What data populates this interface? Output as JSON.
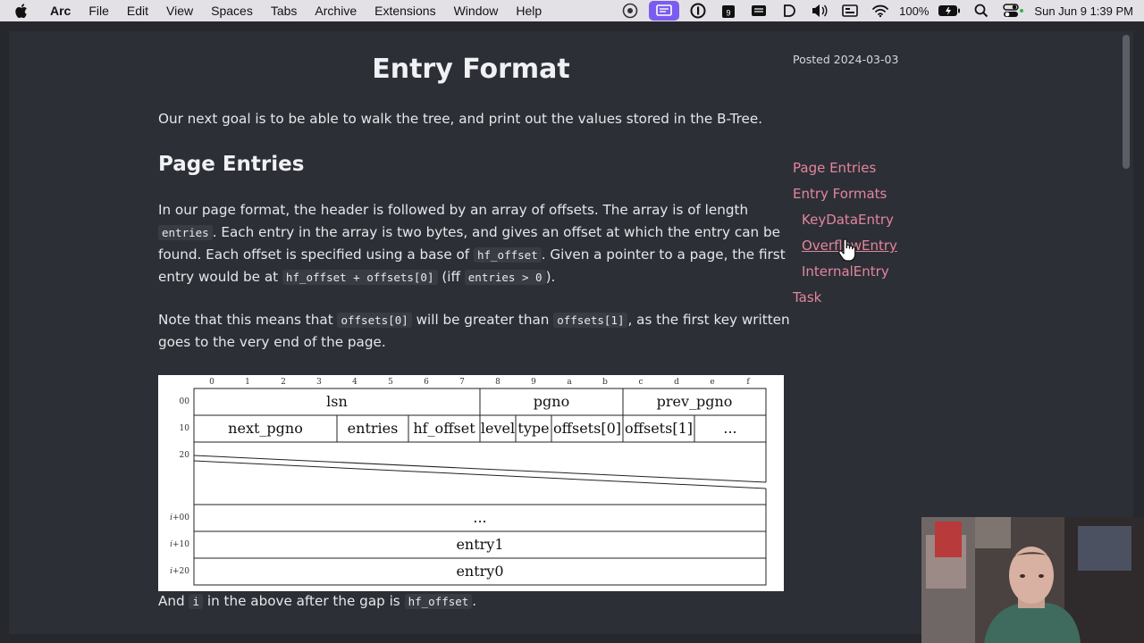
{
  "menubar": {
    "app_name": "Arc",
    "items": [
      "File",
      "Edit",
      "View",
      "Spaces",
      "Tabs",
      "Archive",
      "Extensions",
      "Window",
      "Help"
    ],
    "battery_percent": "100%",
    "datetime": "Sun Jun 9  1:39 PM",
    "icons": [
      "apple-icon",
      "camera-icon",
      "screen-share-icon",
      "onepassword-icon",
      "calendar-icon",
      "grid-icon",
      "d-icon",
      "volume-icon",
      "display-icon",
      "wifi-icon",
      "battery-icon",
      "search-icon",
      "control-center-icon"
    ]
  },
  "article": {
    "title": "Entry Format",
    "posted": "Posted 2024-03-03",
    "intro": "Our next goal is to be able to walk the tree, and print out the values stored in the B-Tree.",
    "section_heading": "Page Entries",
    "para1": {
      "t1": "In our page format, the header is followed by an array of offsets. The array is of length",
      "c1": "entries",
      "t2": ". Each entry in the array is two bytes, and gives an offset at which the entry can be found. Each offset is specified using a base of",
      "c2": "hf_offset",
      "t3": ". Given a pointer to a page, the first entry would be at",
      "c3": "hf_offset + offsets[0]",
      "t4": "(iff",
      "c4": "entries > 0",
      "t5": ")."
    },
    "para2": {
      "t1": "Note that this means that",
      "c1": "offsets[0]",
      "t2": "will be greater than",
      "c2": "offsets[1]",
      "t3": ", as the first key written goes to the very end of the page."
    },
    "para3": {
      "t1": "And",
      "c1": "i",
      "t2": "in the above after the gap is",
      "c2": "hf_offset",
      "t3": "."
    }
  },
  "diagram": {
    "columns": [
      "0",
      "1",
      "2",
      "3",
      "4",
      "5",
      "6",
      "7",
      "8",
      "9",
      "a",
      "b",
      "c",
      "d",
      "e",
      "f"
    ],
    "row_labels": [
      "00",
      "10",
      "20"
    ],
    "row_labels_i": [
      {
        "i": "i",
        "rest": "+00"
      },
      {
        "i": "i",
        "rest": "+10"
      },
      {
        "i": "i",
        "rest": "+20"
      }
    ],
    "row0": [
      "lsn",
      "pgno",
      "prev_pgno"
    ],
    "row1": [
      "next_pgno",
      "entries",
      "hf_offset",
      "level",
      "type",
      "offsets[0]",
      "offsets[1]",
      "..."
    ],
    "ellipsis": "...",
    "entry1": "entry1",
    "entry0": "entry0"
  },
  "toc": [
    {
      "label": "Page Entries",
      "level": 1
    },
    {
      "label": "Entry Formats",
      "level": 1
    },
    {
      "label": "KeyDataEntry",
      "level": 2
    },
    {
      "label": "OverflowEntry",
      "level": 2
    },
    {
      "label": "InternalEntry",
      "level": 2
    },
    {
      "label": "Task",
      "level": 1
    }
  ],
  "colors": {
    "page_background": "#2d2f36",
    "text": "#e7e8ec",
    "toc_link": "#e2869d",
    "menubar_background": "#e4e1e6",
    "menubar_selected": "#7a5cf0"
  }
}
